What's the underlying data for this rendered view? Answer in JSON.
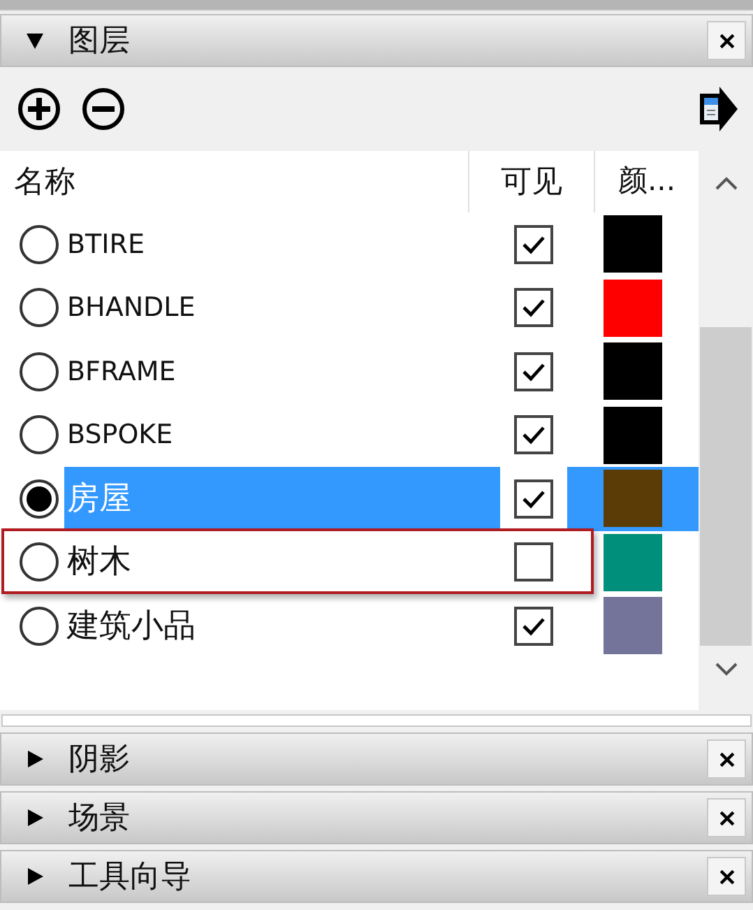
{
  "layers_panel": {
    "title": "图层",
    "expanded": true,
    "columns": [
      "名称",
      "可见",
      "颜..."
    ],
    "layers": [
      {
        "name": "BTIRE",
        "active": false,
        "selected": false,
        "visible": true,
        "color": "#000000",
        "outlined": false
      },
      {
        "name": "BHANDLE",
        "active": false,
        "selected": false,
        "visible": true,
        "color": "#ff0000",
        "outlined": false
      },
      {
        "name": "BFRAME",
        "active": false,
        "selected": false,
        "visible": true,
        "color": "#000000",
        "outlined": false
      },
      {
        "name": "BSPOKE",
        "active": false,
        "selected": false,
        "visible": true,
        "color": "#000000",
        "outlined": false
      },
      {
        "name": "房屋",
        "active": true,
        "selected": true,
        "visible": true,
        "color": "#5c3c06",
        "outlined": false
      },
      {
        "name": "树木",
        "active": false,
        "selected": false,
        "visible": false,
        "color": "#008f7a",
        "outlined": true
      },
      {
        "name": "建筑小品",
        "active": false,
        "selected": false,
        "visible": true,
        "color": "#74739a",
        "outlined": false
      }
    ]
  },
  "collapsed_panels": [
    {
      "title": "阴影",
      "expanded": false
    },
    {
      "title": "场景",
      "expanded": false
    },
    {
      "title": "工具向导",
      "expanded": false
    }
  ]
}
